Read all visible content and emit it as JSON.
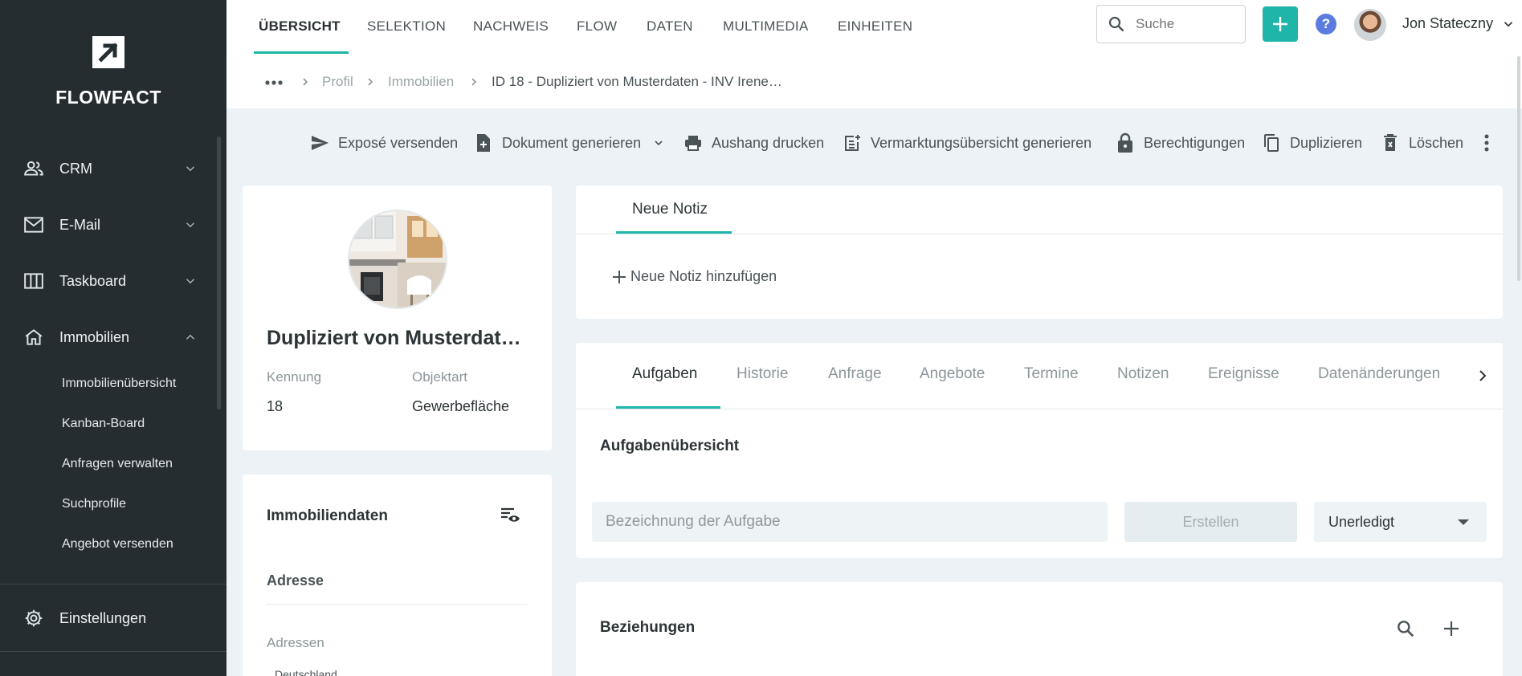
{
  "app": {
    "brand": "FLOWFACT"
  },
  "sidebar": {
    "items": [
      {
        "label": "CRM",
        "icon": "people-icon"
      },
      {
        "label": "E-Mail",
        "icon": "mail-icon"
      },
      {
        "label": "Taskboard",
        "icon": "columns-icon"
      },
      {
        "label": "Immobilien",
        "icon": "home-icon"
      }
    ],
    "subitems": [
      "Immobilienübersicht",
      "Kanban-Board",
      "Anfragen verwalten",
      "Suchprofile",
      "Angebot versenden"
    ],
    "settings": "Einstellungen"
  },
  "topnav": {
    "tabs": [
      "ÜBERSICHT",
      "SELEKTION",
      "NACHWEIS",
      "FLOW",
      "DATEN",
      "MULTIMEDIA",
      "EINHEITEN"
    ],
    "active_tab": "ÜBERSICHT",
    "search_placeholder": "Suche",
    "user_name": "Jon Stateczny"
  },
  "breadcrumb": {
    "items": [
      "Profil",
      "Immobilien",
      "ID 18 - Dupliziert von Musterdaten - INV Irene…"
    ]
  },
  "actions": [
    {
      "label": "Exposé versenden",
      "icon": "send-icon"
    },
    {
      "label": "Dokument generieren",
      "icon": "document-add-icon"
    },
    {
      "label": "Aushang drucken",
      "icon": "printer-icon"
    },
    {
      "label": "Vermarktungsübersicht generieren",
      "icon": "post-add-icon"
    },
    {
      "label": "Berechtigungen",
      "icon": "lock-icon"
    },
    {
      "label": "Duplizieren",
      "icon": "copy-icon"
    },
    {
      "label": "Löschen",
      "icon": "trash-icon"
    }
  ],
  "property": {
    "title": "Dupliziert von Musterdat…",
    "kennung_label": "Kennung",
    "kennung_value": "18",
    "objektart_label": "Objektart",
    "objektart_value": "Gewerbefläche"
  },
  "immodaten": {
    "title": "Immobiliendaten",
    "address_section": "Adresse",
    "addresses_label": "Adressen",
    "country": "Deutschland"
  },
  "notes": {
    "tab": "Neue Notiz",
    "add_label": "Neue Notiz hinzufügen"
  },
  "activity": {
    "tabs": [
      "Aufgaben",
      "Historie",
      "Anfrage",
      "Angebote",
      "Termine",
      "Notizen",
      "Ereignisse",
      "Datenänderungen"
    ],
    "active_tab": "Aufgaben",
    "overview_title": "Aufgabenübersicht",
    "task_placeholder": "Bezeichnung der Aufgabe",
    "create_label": "Erstellen",
    "status_value": "Unerledigt"
  },
  "relations": {
    "title": "Beziehungen"
  },
  "colors": {
    "accent": "#1fb5a8",
    "sidebar": "#262d31",
    "help": "#5b7be0"
  }
}
